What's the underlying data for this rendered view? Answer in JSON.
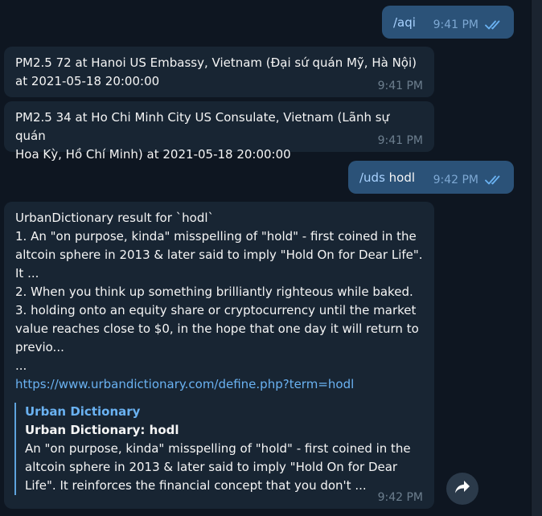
{
  "messages": [
    {
      "direction": "outgoing",
      "command": "/aqi",
      "arg": "",
      "time": "9:41 PM",
      "status": "read"
    },
    {
      "direction": "incoming",
      "text": "PM2.5 72 at Hanoi US Embassy, Vietnam (Đại sứ quán Mỹ, Hà Nội)\nat 2021-05-18 20:00:00",
      "time": "9:41 PM"
    },
    {
      "direction": "incoming",
      "text": "PM2.5 34 at Ho Chi Minh City US Consulate, Vietnam (Lãnh sự quán\nHoa Kỳ, Hồ Chí Minh) at 2021-05-18 20:00:00",
      "time": "9:41 PM"
    },
    {
      "direction": "outgoing",
      "command": "/uds",
      "arg": " hodl",
      "time": "9:42 PM",
      "status": "read"
    },
    {
      "direction": "incoming",
      "text": "UrbanDictionary result for `hodl`\n1. An \"on purpose, kinda\" misspelling of \"hold\" - first coined in the\naltcoin sphere in 2013 & later said to imply \"Hold On for Dear Life\".\nIt ...\n2. When you think up something brilliantly righteous while baked.\n3. holding onto an equity share or cryptocurrency until the market\nvalue reaches close to $0, in the hope that one day it will return to\nprevio...\n...",
      "link": "https://www.urbandictionary.com/define.php?term=hodl",
      "preview": {
        "site": "Urban Dictionary",
        "title": "Urban Dictionary: hodl",
        "description": "An \"on purpose, kinda\" misspelling of \"hold\" - first coined in the\naltcoin sphere in 2013 & later said to imply \"Hold On for Dear\nLife\". It reinforces the financial concept that you don't ..."
      },
      "time": "9:42 PM"
    }
  ],
  "icons": {
    "read_checks": "double-check-icon",
    "forward": "share-arrow-icon"
  },
  "colors": {
    "background": "#0e1621",
    "incoming_bubble": "#182533",
    "outgoing_bubble": "#2b5278",
    "link": "#6ab2f2"
  }
}
